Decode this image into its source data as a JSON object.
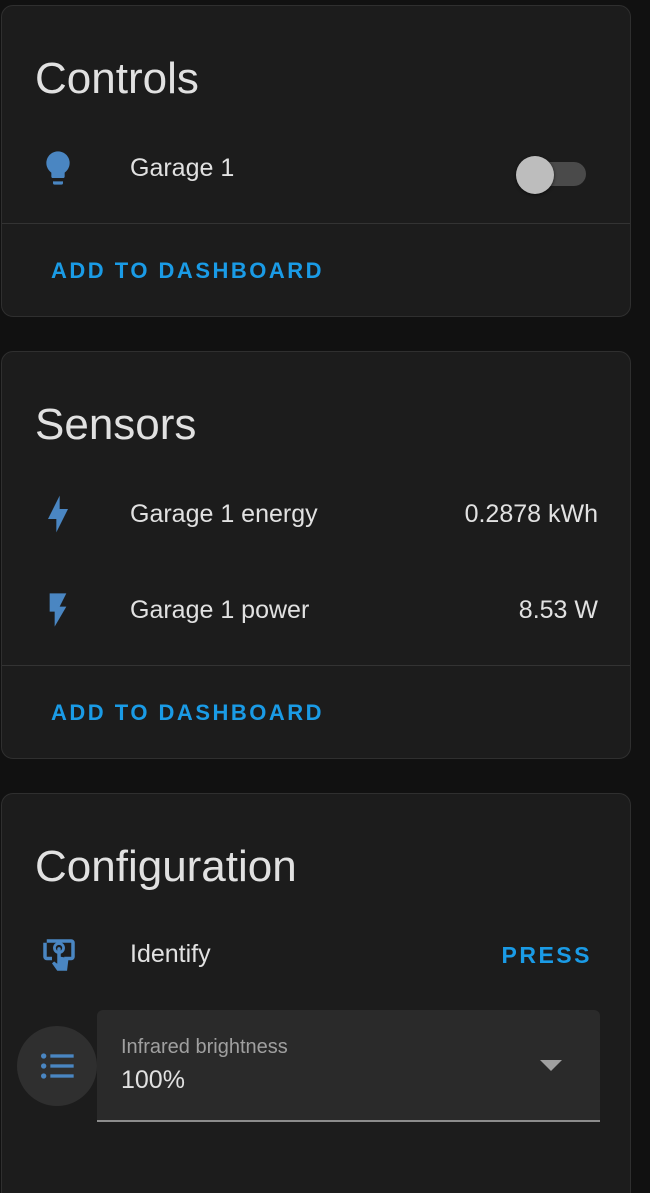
{
  "colors": {
    "accent": "#1a9be6",
    "icon": "#4a86c2",
    "card_bg": "#1c1c1c",
    "page_bg": "#111111"
  },
  "controls": {
    "title": "Controls",
    "items": [
      {
        "label": "Garage 1",
        "icon": "lightbulb-icon",
        "state": "off"
      }
    ],
    "add_label": "ADD TO DASHBOARD"
  },
  "sensors": {
    "title": "Sensors",
    "items": [
      {
        "label": "Garage 1 energy",
        "value": "0.2878 kWh",
        "icon": "lightning-bolt-icon"
      },
      {
        "label": "Garage 1 power",
        "value": "8.53 W",
        "icon": "flash-icon"
      }
    ],
    "add_label": "ADD TO DASHBOARD"
  },
  "configuration": {
    "title": "Configuration",
    "identify": {
      "label": "Identify",
      "action": "PRESS",
      "icon": "touch-screen-icon"
    },
    "infrared": {
      "label": "Infrared brightness",
      "value": "100%",
      "icon": "format-list-icon"
    }
  }
}
